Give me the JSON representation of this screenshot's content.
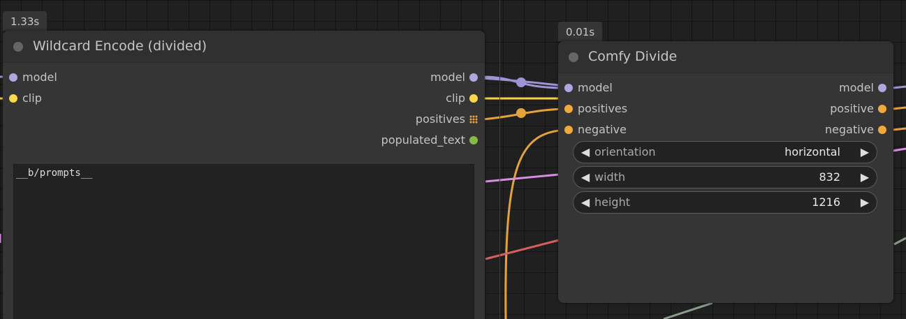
{
  "colors": {
    "model": "#b2a6e0",
    "clip": "#fbd84a",
    "conditioning": "#f1a93c",
    "string": "#86b94a",
    "link_model": "#9e94d4",
    "link_clip": "#f6cf43",
    "link_cond": "#e5a23a",
    "link_pink": "#d78ee2",
    "link_red": "#d65f5f",
    "link_gray": "#8b9a8b"
  },
  "nodes": {
    "wildcard": {
      "timing": "1.33s",
      "title": "Wildcard Encode (divided)",
      "inputs": [
        {
          "label": "model",
          "type": "model"
        },
        {
          "label": "clip",
          "type": "clip"
        }
      ],
      "outputs": [
        {
          "label": "model",
          "type": "model",
          "icon": "circle"
        },
        {
          "label": "clip",
          "type": "clip",
          "icon": "circle"
        },
        {
          "label": "positives",
          "type": "conditioning",
          "icon": "grid"
        },
        {
          "label": "populated_text",
          "type": "string",
          "icon": "circle"
        }
      ],
      "text_value": "__b/prompts__"
    },
    "divide": {
      "timing": "0.01s",
      "title": "Comfy Divide",
      "inputs": [
        {
          "label": "model",
          "type": "model"
        },
        {
          "label": "positives",
          "type": "conditioning"
        },
        {
          "label": "negative",
          "type": "conditioning"
        }
      ],
      "outputs": [
        {
          "label": "model",
          "type": "model"
        },
        {
          "label": "positive",
          "type": "conditioning"
        },
        {
          "label": "negative",
          "type": "conditioning"
        }
      ],
      "widgets": [
        {
          "label": "orientation",
          "value": "horizontal"
        },
        {
          "label": "width",
          "value": "832"
        },
        {
          "label": "height",
          "value": "1216"
        }
      ]
    }
  }
}
